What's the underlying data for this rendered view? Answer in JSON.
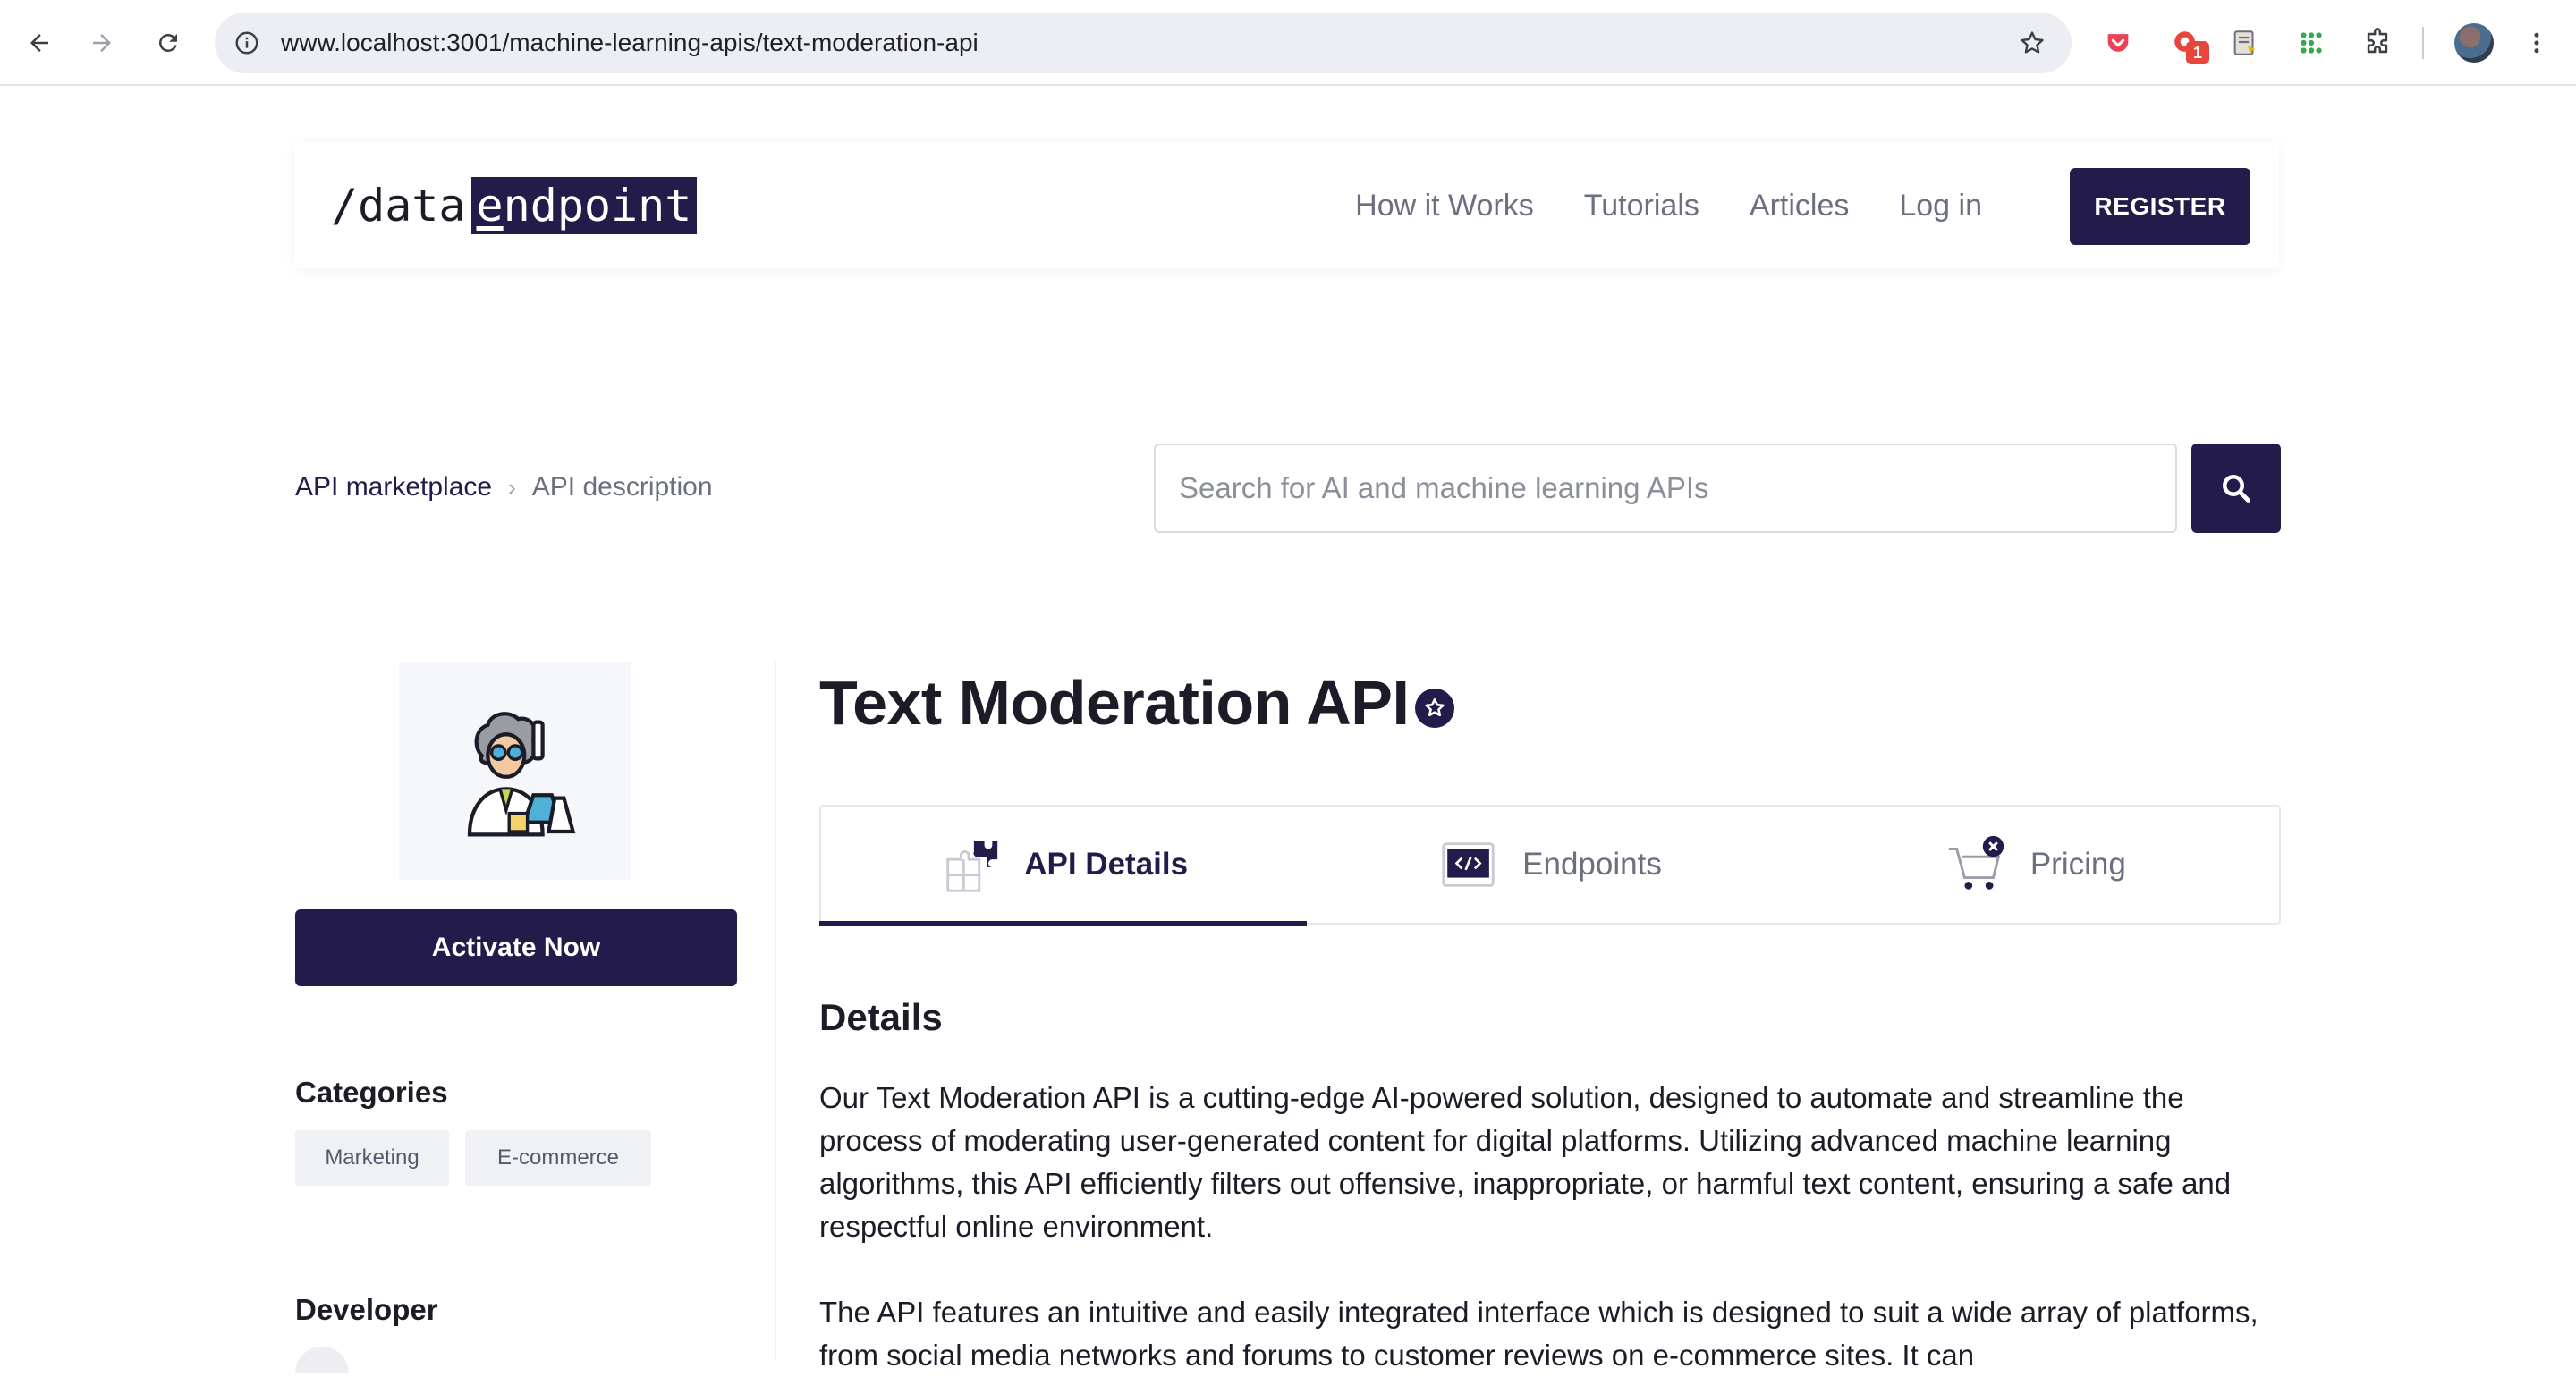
{
  "browser": {
    "url": "www.localhost:3001/machine-learning-apis/text-moderation-api",
    "extension_badge": "1"
  },
  "header": {
    "logo_plain": "/data",
    "logo_highlight_first": "e",
    "logo_highlight_rest": "ndpoint",
    "nav": [
      "How it Works",
      "Tutorials",
      "Articles",
      "Log in"
    ],
    "register_label": "REGISTER"
  },
  "breadcrumb": {
    "root": "API marketplace",
    "current": "API description"
  },
  "search": {
    "placeholder": "Search for AI and machine learning APIs"
  },
  "sidebar": {
    "activate_label": "Activate Now",
    "categories_heading": "Categories",
    "categories": [
      "Marketing",
      "E-commerce"
    ],
    "developer_heading": "Developer"
  },
  "main": {
    "title": "Text Moderation API",
    "tabs": [
      {
        "label": "API Details",
        "icon": "puzzle-icon",
        "active": true
      },
      {
        "label": "Endpoints",
        "icon": "code-window-icon",
        "active": false
      },
      {
        "label": "Pricing",
        "icon": "cart-icon",
        "active": false
      }
    ],
    "details_heading": "Details",
    "paragraph_1": "Our Text Moderation API is a cutting-edge AI-powered solution, designed to automate and streamline the process of moderating user-generated content for digital platforms. Utilizing advanced machine learning algorithms, this API efficiently filters out offensive, inappropriate, or harmful text content, ensuring a safe and respectful online environment.",
    "paragraph_2": "The API features an intuitive and easily integrated interface which is designed to suit a wide array of platforms, from social media networks and forums to customer reviews on e-commerce sites. It can"
  },
  "colors": {
    "brand": "#231c4a",
    "muted_text": "#6b6f80",
    "chip_bg": "#f0f1f4"
  }
}
